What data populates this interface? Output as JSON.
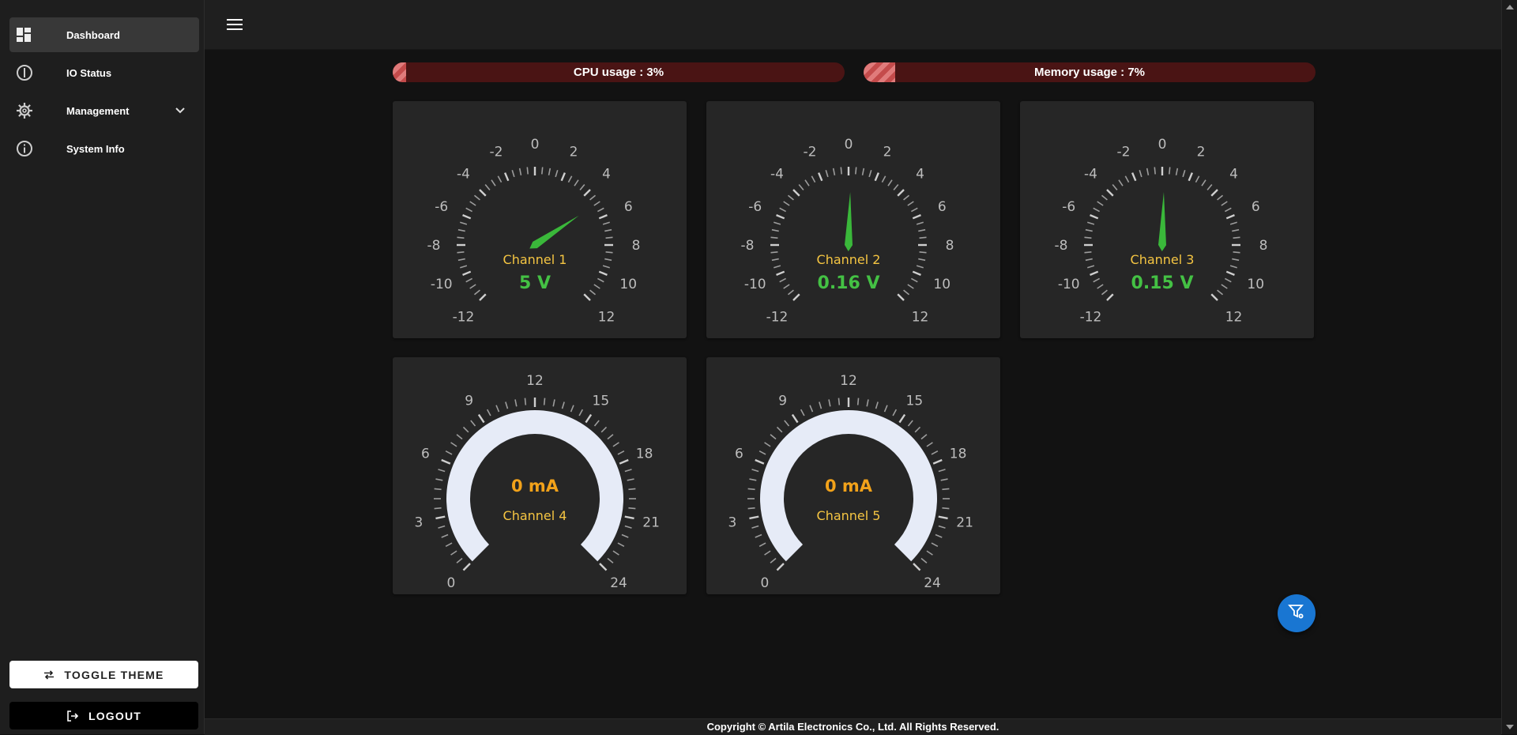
{
  "sidebar": {
    "items": [
      {
        "label": "Dashboard",
        "icon": "dashboard-icon"
      },
      {
        "label": "IO Status",
        "icon": "io-status-icon"
      },
      {
        "label": "Management",
        "icon": "gear-icon"
      },
      {
        "label": "System Info",
        "icon": "info-icon"
      }
    ],
    "toggle_theme": "TOGGLE THEME",
    "logout": "LOGOUT"
  },
  "usage": {
    "cpu": {
      "label": "CPU usage : 3%",
      "percent": 3
    },
    "memory": {
      "label": "Memory usage : 7%",
      "percent": 7
    }
  },
  "voltage_gauges": [
    {
      "channel": "Channel 1",
      "value": 5,
      "value_text": "5 V"
    },
    {
      "channel": "Channel 2",
      "value": 0.16,
      "value_text": "0.16 V"
    },
    {
      "channel": "Channel 3",
      "value": 0.15,
      "value_text": "0.15 V"
    }
  ],
  "voltage_scale": {
    "min": -12,
    "max": 12,
    "labels": [
      "-12",
      "-10",
      "-8",
      "-6",
      "-4",
      "-2",
      "0",
      "2",
      "4",
      "6",
      "8",
      "10",
      "12"
    ]
  },
  "current_gauges": [
    {
      "channel": "Channel 4",
      "value": 0,
      "value_text": "0 mA"
    },
    {
      "channel": "Channel 5",
      "value": 0,
      "value_text": "0 mA"
    }
  ],
  "current_scale": {
    "min": 0,
    "max": 24,
    "labels": [
      "0",
      "3",
      "6",
      "9",
      "12",
      "15",
      "18",
      "21",
      "24"
    ]
  },
  "colors": {
    "needle": "#3ab83a",
    "value_green": "#44c144",
    "channel_label": "#f5c542",
    "value_orange": "#f2a21a",
    "arc": "#e6ebf7",
    "fab": "#1976d2"
  },
  "footer": {
    "text": "Copyright © Artila Electronics Co., Ltd. All Rights Reserved."
  }
}
